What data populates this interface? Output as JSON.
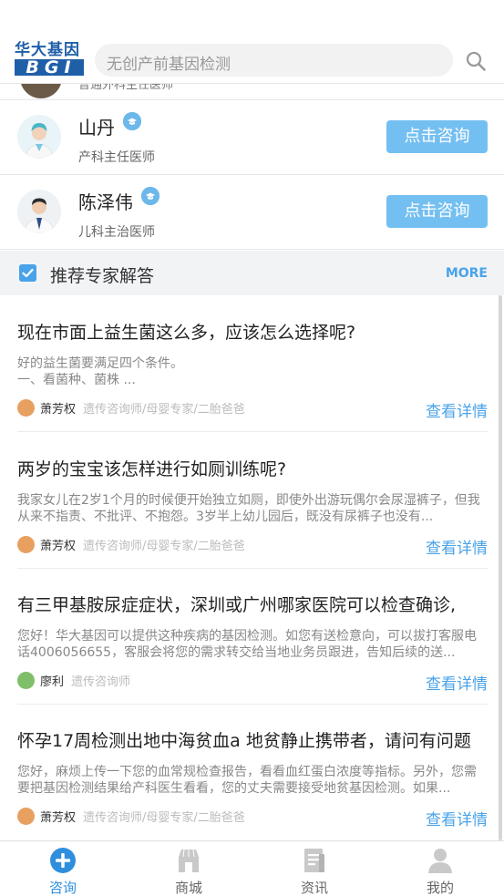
{
  "header": {
    "logo_cn": "华大基因",
    "logo_en": "BGI",
    "search_placeholder": "无创产前基因检测"
  },
  "doctors": [
    {
      "title": "普通外科主任医师"
    },
    {
      "name": "山丹",
      "title": "产科主任医师",
      "button": "点击咨询"
    },
    {
      "name": "陈泽伟",
      "title": "儿科主治医师",
      "button": "点击咨询"
    }
  ],
  "section": {
    "title": "推荐专家解答",
    "more": "MORE"
  },
  "articles": [
    {
      "title": "现在市面上益生菌这么多，应该怎么选择呢?",
      "excerpt": "好的益生菌要满足四个条件。\n一、看菌种、菌株 ...",
      "author": "萧芳权",
      "role": "遗传咨询师/母婴专家/二胎爸爸",
      "detail": "查看详情"
    },
    {
      "title": "两岁的宝宝该怎样进行如厕训练呢?",
      "excerpt": "我家女儿在2岁1个月的时候便开始独立如厕，即使外出游玩偶尔会尿湿裤子，但我从来不指责、不批评、不抱怨。3岁半上幼儿园后，既没有尿裤子也没有...",
      "author": "萧芳权",
      "role": "遗传咨询师/母婴专家/二胎爸爸",
      "detail": "查看详情"
    },
    {
      "title": "有三甲基胺尿症症状，深圳或广州哪家医院可以检查确诊,",
      "excerpt": "您好！华大基因可以提供这种疾病的基因检测。如您有送检意向，可以拔打客服电话4006056655，客服会将您的需求转交给当地业务员跟进，告知后续的送...",
      "author": "廖利",
      "role": "遗传咨询师",
      "detail": "查看详情"
    },
    {
      "title": "怀孕17周检测出地中海贫血a 地贫静止携带者，请问有问题",
      "excerpt": "您好，麻烦上传一下您的血常规检查报告，看看血红蛋白浓度等指标。另外，您需要把基因检测结果给产科医生看看，您的丈夫需要接受地贫基因检测。如果...",
      "author": "萧芳权",
      "role": "遗传咨询师/母婴专家/二胎爸爸",
      "detail": "查看详情"
    }
  ],
  "nav": [
    {
      "label": "咨询",
      "icon": "consult-plus-icon",
      "active": true
    },
    {
      "label": "商城",
      "icon": "store-icon",
      "active": false
    },
    {
      "label": "资讯",
      "icon": "news-icon",
      "active": false
    },
    {
      "label": "我的",
      "icon": "person-icon",
      "active": false
    }
  ],
  "colors": {
    "accent": "#4aa3e8",
    "button": "#74bff1",
    "brand": "#1f5fa8"
  }
}
